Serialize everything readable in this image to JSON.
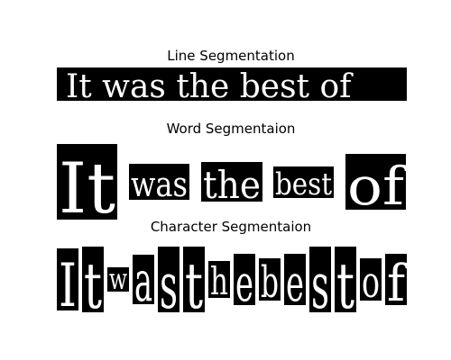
{
  "panels": [
    {
      "id": "line",
      "title": "Line Segmentation",
      "segments": [
        "It was the best of"
      ]
    },
    {
      "id": "word",
      "title": "Word Segmentaion",
      "segments": [
        "It",
        "was",
        "the",
        "best",
        "of"
      ]
    },
    {
      "id": "character",
      "title": "Character Segmentaion",
      "segments": [
        "I",
        "t",
        "w",
        "a",
        "s",
        "t",
        "h",
        "e",
        "b",
        "e",
        "s",
        "t",
        "o",
        "f"
      ]
    }
  ],
  "colors": {
    "background": "#ffffff",
    "box": "#000000",
    "text": "#ffffff",
    "title": "#000000"
  }
}
